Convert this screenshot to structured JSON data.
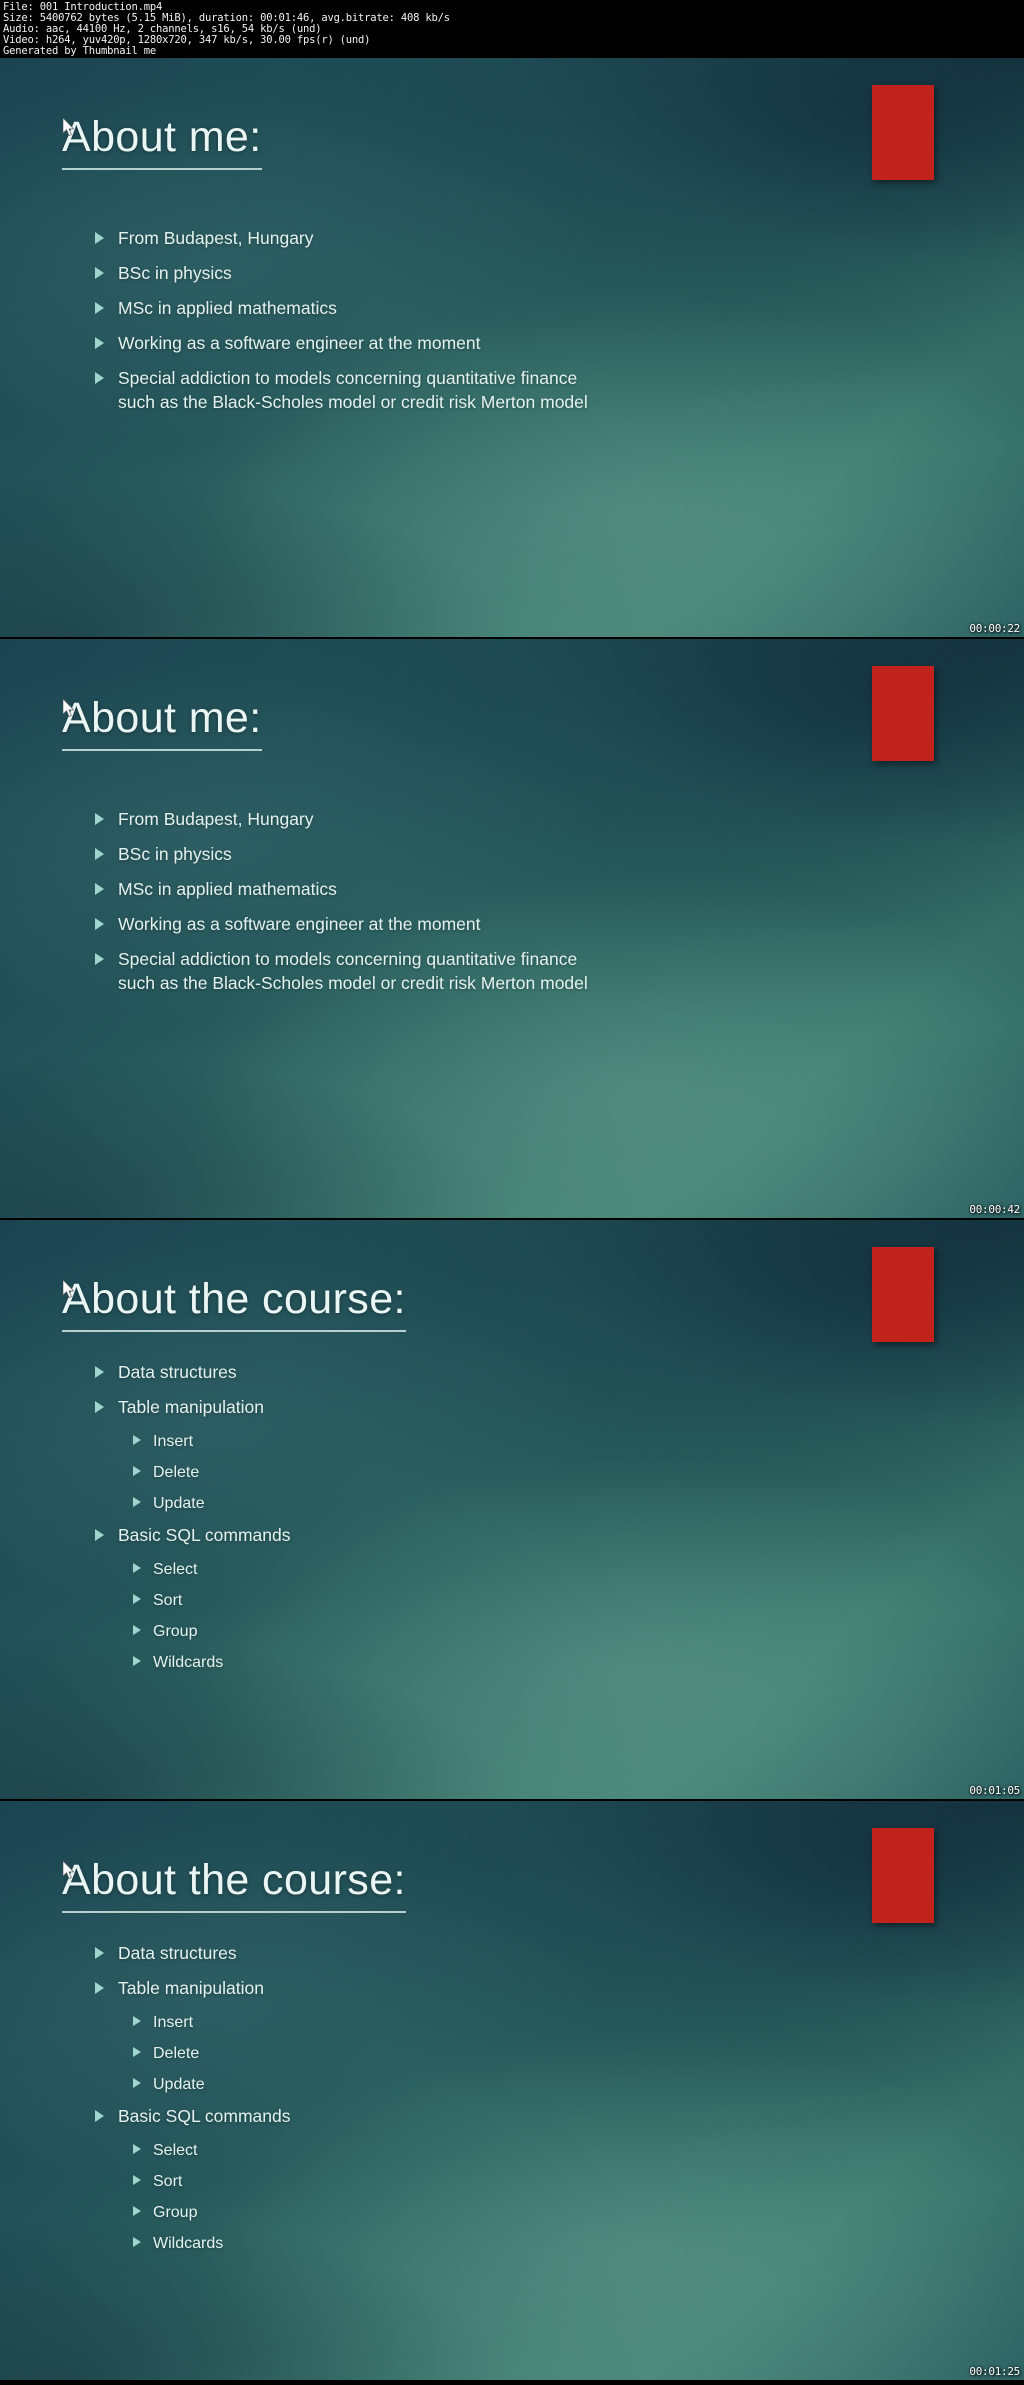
{
  "file_info": {
    "line1": "File: 001 Introduction.mp4",
    "line2": "Size: 5400762 bytes (5.15 MiB), duration: 00:01:46, avg.bitrate: 408 kb/s",
    "line3": "Audio: aac, 44100 Hz, 2 channels, s16, 54 kb/s (und)",
    "line4": "Video: h264, yuv420p, 1280x720, 347 kb/s, 30.00 fps(r) (und)",
    "line5": "Generated by Thumbnail me"
  },
  "colors": {
    "accent_red": "#c1221c",
    "bullet_teal": "#9ed6ce",
    "text_light": "#e4f2ef",
    "background_dark": "#1b4451"
  },
  "slides": [
    {
      "title": "About me:",
      "timestamp": "00:00:22",
      "bullets": [
        {
          "level": 1,
          "text": "From Budapest, Hungary"
        },
        {
          "level": 1,
          "text": "BSc in physics"
        },
        {
          "level": 1,
          "text": "MSc in applied mathematics"
        },
        {
          "level": 1,
          "text": "Working as a software engineer at the moment"
        },
        {
          "level": 1,
          "text": "Special addiction to models concerning quantitative finance such as the Black-Scholes model or credit risk Merton model"
        }
      ]
    },
    {
      "title": "About me:",
      "timestamp": "00:00:42",
      "bullets": [
        {
          "level": 1,
          "text": "From Budapest, Hungary"
        },
        {
          "level": 1,
          "text": "BSc in physics"
        },
        {
          "level": 1,
          "text": "MSc in applied mathematics"
        },
        {
          "level": 1,
          "text": "Working as a software engineer at the moment"
        },
        {
          "level": 1,
          "text": "Special addiction to models concerning quantitative finance such as the Black-Scholes model or credit risk Merton model"
        }
      ]
    },
    {
      "title": "About the course:",
      "timestamp": "00:01:05",
      "bullets": [
        {
          "level": 1,
          "text": "Data structures"
        },
        {
          "level": 1,
          "text": "Table manipulation"
        },
        {
          "level": 2,
          "text": "Insert"
        },
        {
          "level": 2,
          "text": "Delete"
        },
        {
          "level": 2,
          "text": "Update"
        },
        {
          "level": 1,
          "text": "Basic SQL commands"
        },
        {
          "level": 2,
          "text": "Select"
        },
        {
          "level": 2,
          "text": "Sort"
        },
        {
          "level": 2,
          "text": "Group"
        },
        {
          "level": 2,
          "text": "Wildcards"
        }
      ]
    },
    {
      "title": "About the course:",
      "timestamp": "00:01:25",
      "bullets": [
        {
          "level": 1,
          "text": "Data structures"
        },
        {
          "level": 1,
          "text": "Table manipulation"
        },
        {
          "level": 2,
          "text": "Insert"
        },
        {
          "level": 2,
          "text": "Delete"
        },
        {
          "level": 2,
          "text": "Update"
        },
        {
          "level": 1,
          "text": "Basic SQL commands"
        },
        {
          "level": 2,
          "text": "Select"
        },
        {
          "level": 2,
          "text": "Sort"
        },
        {
          "level": 2,
          "text": "Group"
        },
        {
          "level": 2,
          "text": "Wildcards"
        }
      ]
    }
  ]
}
